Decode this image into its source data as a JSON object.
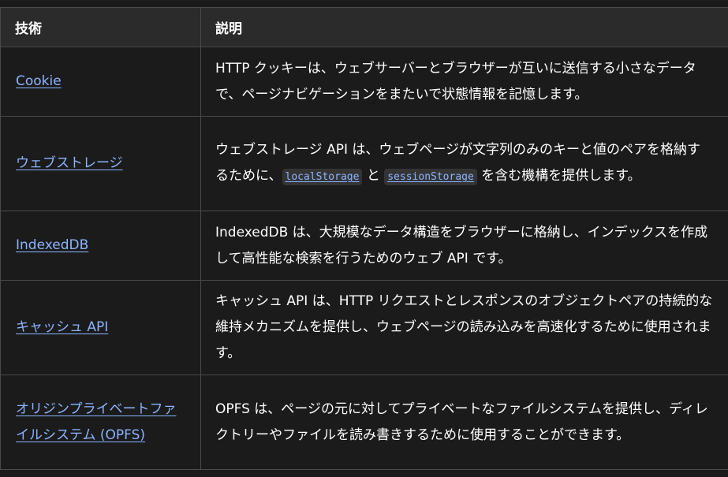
{
  "headers": {
    "tech": "技術",
    "desc": "説明"
  },
  "rows": [
    {
      "name": "Cookie",
      "desc": "HTTP クッキーは、ウェブサーバーとブラウザーが互いに送信する小さなデータで、ページナビゲーションをまたいで状態情報を記憶します。"
    },
    {
      "name": "ウェブストレージ",
      "desc_before": "ウェブストレージ API は、ウェブページが文字列のみのキーと値のペアを格納するために、",
      "code1": "localStorage",
      "desc_mid": " と ",
      "code2": "sessionStorage",
      "desc_after": " を含む機構を提供します。"
    },
    {
      "name": "IndexedDB",
      "desc": "IndexedDB は、大規模なデータ構造をブラウザーに格納し、インデックスを作成して高性能な検索を行うためのウェブ API です。"
    },
    {
      "name": "キャッシュ API",
      "desc": "キャッシュ API は、HTTP リクエストとレスポンスのオブジェクトペアの持続的な維持メカニズムを提供し、ウェブページの読み込みを高速化するために使用されます。"
    },
    {
      "name": "オリジンプライベートファイルシステム (OPFS)",
      "desc": "OPFS は、ページの元に対してプライベートなファイルシステムを提供し、ディレクトリーやファイルを読み書きするために使用することができます。"
    }
  ]
}
